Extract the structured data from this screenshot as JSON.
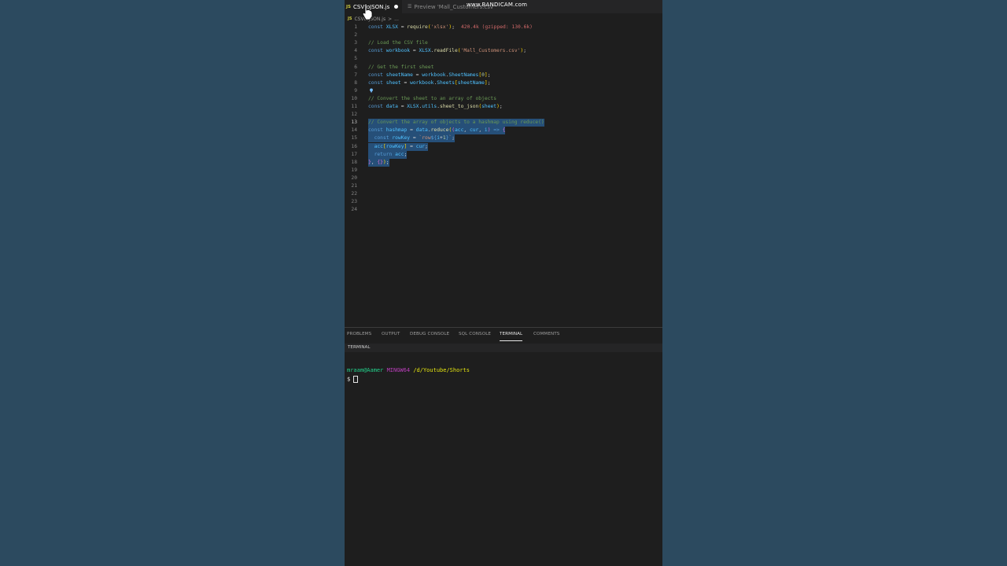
{
  "tabs": [
    {
      "label": "CSVtoJSON.js",
      "badge": "JS",
      "modified": true
    },
    {
      "label": "Preview 'Mall_Customers.csv'"
    }
  ],
  "watermark": {
    "text": "www.BANDICAM.com"
  },
  "breadcrumb": {
    "badge": "JS",
    "file": "CSVtoJSON.js",
    "sep": ">",
    "rest": "..."
  },
  "editor": {
    "lines": [
      {
        "n": "1",
        "parts": [
          [
            "kw",
            "const "
          ],
          [
            "var",
            "XLSX"
          ],
          [
            "pl",
            " = "
          ],
          [
            "fn",
            "require"
          ],
          [
            "br",
            "("
          ],
          [
            "str",
            "'xlsx'"
          ],
          [
            "br",
            ")"
          ],
          [
            "pl",
            ";"
          ]
        ],
        "hint": "420.4k (gzipped: 130.6k)"
      },
      {
        "n": "2",
        "parts": []
      },
      {
        "n": "3",
        "parts": [
          [
            "cm",
            "// Load the CSV file"
          ]
        ]
      },
      {
        "n": "4",
        "parts": [
          [
            "kw",
            "const "
          ],
          [
            "var",
            "workbook"
          ],
          [
            "pl",
            " = "
          ],
          [
            "var",
            "XLSX"
          ],
          [
            "pl",
            "."
          ],
          [
            "fn",
            "readFile"
          ],
          [
            "br",
            "("
          ],
          [
            "str",
            "'Mall_Customers.csv'"
          ],
          [
            "br",
            ")"
          ],
          [
            "pl",
            ";"
          ]
        ]
      },
      {
        "n": "5",
        "parts": []
      },
      {
        "n": "6",
        "parts": [
          [
            "cm",
            "// Get the first sheet"
          ]
        ]
      },
      {
        "n": "7",
        "parts": [
          [
            "kw",
            "const "
          ],
          [
            "var",
            "sheetName"
          ],
          [
            "pl",
            " = "
          ],
          [
            "var",
            "workbook"
          ],
          [
            "pl",
            "."
          ],
          [
            "var",
            "SheetNames"
          ],
          [
            "br",
            "["
          ],
          [
            "num",
            "0"
          ],
          [
            "br",
            "]"
          ],
          [
            "pl",
            ";"
          ]
        ]
      },
      {
        "n": "8",
        "parts": [
          [
            "kw",
            "const "
          ],
          [
            "var",
            "sheet"
          ],
          [
            "pl",
            " = "
          ],
          [
            "var",
            "workbook"
          ],
          [
            "pl",
            "."
          ],
          [
            "var",
            "Sheets"
          ],
          [
            "br",
            "["
          ],
          [
            "var",
            "sheetName"
          ],
          [
            "br",
            "]"
          ],
          [
            "pl",
            ";"
          ]
        ]
      },
      {
        "n": "9",
        "parts": []
      },
      {
        "n": "10",
        "parts": [
          [
            "cm",
            "// Convert the sheet to an array of objects"
          ]
        ]
      },
      {
        "n": "11",
        "parts": [
          [
            "kw",
            "const "
          ],
          [
            "var",
            "data"
          ],
          [
            "pl",
            " = "
          ],
          [
            "var",
            "XLSX"
          ],
          [
            "pl",
            "."
          ],
          [
            "var",
            "utils"
          ],
          [
            "pl",
            "."
          ],
          [
            "fn",
            "sheet_to_json"
          ],
          [
            "br",
            "("
          ],
          [
            "var",
            "sheet"
          ],
          [
            "br",
            ")"
          ],
          [
            "pl",
            ";"
          ]
        ]
      },
      {
        "n": "12",
        "parts": []
      },
      {
        "n": "13",
        "sel": true,
        "parts": [
          [
            "cm",
            "// Convert the array of objects to a hashmap using reduce()"
          ]
        ]
      },
      {
        "n": "14",
        "sel": true,
        "parts": [
          [
            "kw",
            "const "
          ],
          [
            "var",
            "hashmap"
          ],
          [
            "pl",
            " = "
          ],
          [
            "var",
            "data"
          ],
          [
            "pl",
            "."
          ],
          [
            "fn",
            "reduce"
          ],
          [
            "br",
            "("
          ],
          [
            "br2",
            "("
          ],
          [
            "var",
            "acc"
          ],
          [
            "pl",
            ", "
          ],
          [
            "var",
            "cur"
          ],
          [
            "pl",
            ", "
          ],
          [
            "var",
            "i"
          ],
          [
            "br2",
            ")"
          ],
          [
            "kw",
            " => "
          ],
          [
            "br2",
            "{"
          ]
        ]
      },
      {
        "n": "15",
        "sel": true,
        "parts": [
          [
            "pl",
            "  "
          ],
          [
            "kw",
            "const "
          ],
          [
            "var",
            "rowKey"
          ],
          [
            "pl",
            " = "
          ],
          [
            "str",
            "`row"
          ],
          [
            "tpl",
            "${"
          ],
          [
            "var",
            "i"
          ],
          [
            "pl",
            "+"
          ],
          [
            "num",
            "1"
          ],
          [
            "tpl",
            "}"
          ],
          [
            "str",
            "`"
          ],
          [
            "pl",
            ";"
          ]
        ]
      },
      {
        "n": "16",
        "sel": true,
        "parts": [
          [
            "pl",
            "  "
          ],
          [
            "var",
            "acc"
          ],
          [
            "br",
            "["
          ],
          [
            "var",
            "rowKey"
          ],
          [
            "br",
            "]"
          ],
          [
            "pl",
            " = "
          ],
          [
            "var",
            "cur"
          ],
          [
            "pl",
            ";"
          ]
        ]
      },
      {
        "n": "17",
        "sel": true,
        "parts": [
          [
            "pl",
            "  "
          ],
          [
            "kw",
            "return "
          ],
          [
            "var",
            "acc"
          ],
          [
            "pl",
            ";"
          ]
        ]
      },
      {
        "n": "18",
        "sel": true,
        "parts": [
          [
            "br2",
            "}"
          ],
          [
            "pl",
            ", "
          ],
          [
            "br2",
            "{}"
          ],
          [
            "br",
            ")"
          ],
          [
            "pl",
            ";"
          ]
        ]
      },
      {
        "n": "19",
        "parts": []
      },
      {
        "n": "20",
        "parts": []
      },
      {
        "n": "21",
        "parts": []
      },
      {
        "n": "22",
        "parts": []
      },
      {
        "n": "23",
        "parts": []
      },
      {
        "n": "24",
        "parts": []
      }
    ]
  },
  "panel": {
    "tabs": [
      "PROBLEMS",
      "OUTPUT",
      "DEBUG CONSOLE",
      "SQL CONSOLE",
      "TERMINAL",
      "COMMENTS"
    ],
    "active_tab": "TERMINAL",
    "header": "TERMINAL"
  },
  "terminal": {
    "user": "mraam@Aamer",
    "host": "MINGW64",
    "path": "/d/Youtube/Shorts",
    "prompt": "$"
  },
  "colors": {
    "editor_bg": "#1e1e1e",
    "selection": "#264f78",
    "side_bg": "#2c4a5f"
  }
}
